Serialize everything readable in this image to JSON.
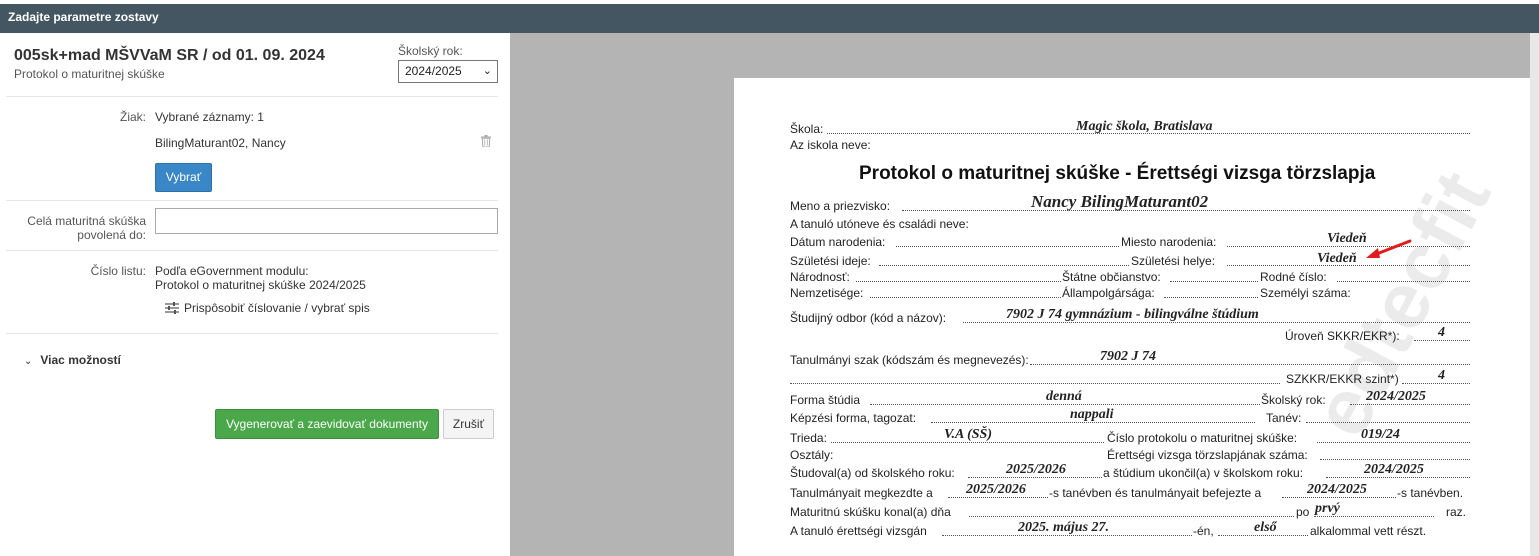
{
  "window": {
    "title": "Zadajte parametre zostavy"
  },
  "header": {
    "title": "005sk+mad MŠVVaM SR / od 01. 09. 2024",
    "subtitle": "Protokol o maturitnej skúške",
    "school_year_label": "Školský rok:",
    "school_year_value": "2024/2025"
  },
  "form": {
    "student_label": "Žiak:",
    "selected_records": "Vybrané záznamy: 1",
    "student_name": "BilingMaturant02, Nancy",
    "select_button": "Vybrať",
    "exam_allowed_label_1": "Celá maturitná skúška",
    "exam_allowed_label_2": "povolená do:",
    "exam_allowed_value": "",
    "sheet_label": "Číslo listu:",
    "sheet_value_1": "Podľa eGovernment modulu:",
    "sheet_value_2": "Protokol o maturitnej skúške 2024/2025",
    "adjust_link": "Prispôsobiť číslovanie / vybrať spis",
    "more_options": "Viac možností",
    "generate_button": "Vygenerovať a zaevidovať dokumenty",
    "cancel_button": "Zrušiť"
  },
  "document": {
    "school_label": "Škola:",
    "school_value": "Magic škola, Bratislava",
    "school_label_hu": "Az iskola neve:",
    "title": "Protokol o maturitnej skúške - Érettségi vizsga törzslapja",
    "name_label": "Meno a priezvisko:",
    "name_value": "Nancy BilingMaturant02",
    "name_label_hu": "A tanuló utóneve és családi neve:",
    "dob_label": "Dátum narodenia:",
    "pob_label": "Miesto narodenia:",
    "pob_value": "Viedeň",
    "dob_label_hu": "Születési ideje:",
    "pob_label_hu": "Születési helye:",
    "pob_value_hu": "Viedeň",
    "nationality_label": "Národnosť:",
    "citizenship_label": "Štátne občianstvo:",
    "birth_number_label": "Rodné číslo:",
    "nationality_label_hu": "Nemzetisége:",
    "citizenship_label_hu": "Állampolgársága:",
    "birth_number_label_hu": "Személyi száma:",
    "field_label": "Študijný odbor (kód a názov):",
    "field_value": "7902 J 74 gymnázium - bilingválne štúdium",
    "level_label": "Úroveň SKKR/EKR*):",
    "level_value": "4",
    "field_label_hu": "Tanulmányi szak (kódszám és megnevezés):",
    "field_value_hu": "7902 J 74",
    "level_label_hu": "SZKKR/EKKR szint*)",
    "level_value_hu": "4",
    "study_form_label": "Forma štúdia",
    "study_form_value": "denná",
    "school_year_label": "Školský rok:",
    "school_year_value": "2024/2025",
    "study_form_label_hu": "Képzési forma, tagozat:",
    "study_form_value_hu": "nappali",
    "school_year_label_hu": "Tanév:",
    "class_label": "Trieda:",
    "class_value": "V.A (SŠ)",
    "protocol_label": "Číslo protokolu o maturitnej skúške:",
    "protocol_value": "019/24",
    "class_label_hu": "Osztály:",
    "protocol_label_hu": "Érettségi vizsga törzslapjának száma:",
    "studied_from_label": "Študoval(a) od školského roku:",
    "studied_from_value": "2025/2026",
    "studied_to_label": "a štúdium ukončil(a) v školskom roku:",
    "studied_to_value": "2024/2025",
    "started_label_hu": "Tanulmányait megkezdte a",
    "started_value_hu": "2025/2026",
    "started_mid_hu": "-s tanévben és tanulmányait befejezte a",
    "finished_value_hu": "2024/2025",
    "finished_end_hu": "-s tanévben.",
    "exam_took_label": "Maturitnú skúšku konal(a) dňa",
    "exam_po_label": "po",
    "exam_po_value": "prvý",
    "exam_raz_label": "raz.",
    "exam_date_label_hu": "A tanuló érettségi vizsgán",
    "exam_date_value_hu": "2025. május 27.",
    "exam_en_hu": "-én,",
    "exam_count_value_hu": "első",
    "exam_end_hu": "alkalommal vett részt.",
    "watermark": "edtecfit"
  }
}
